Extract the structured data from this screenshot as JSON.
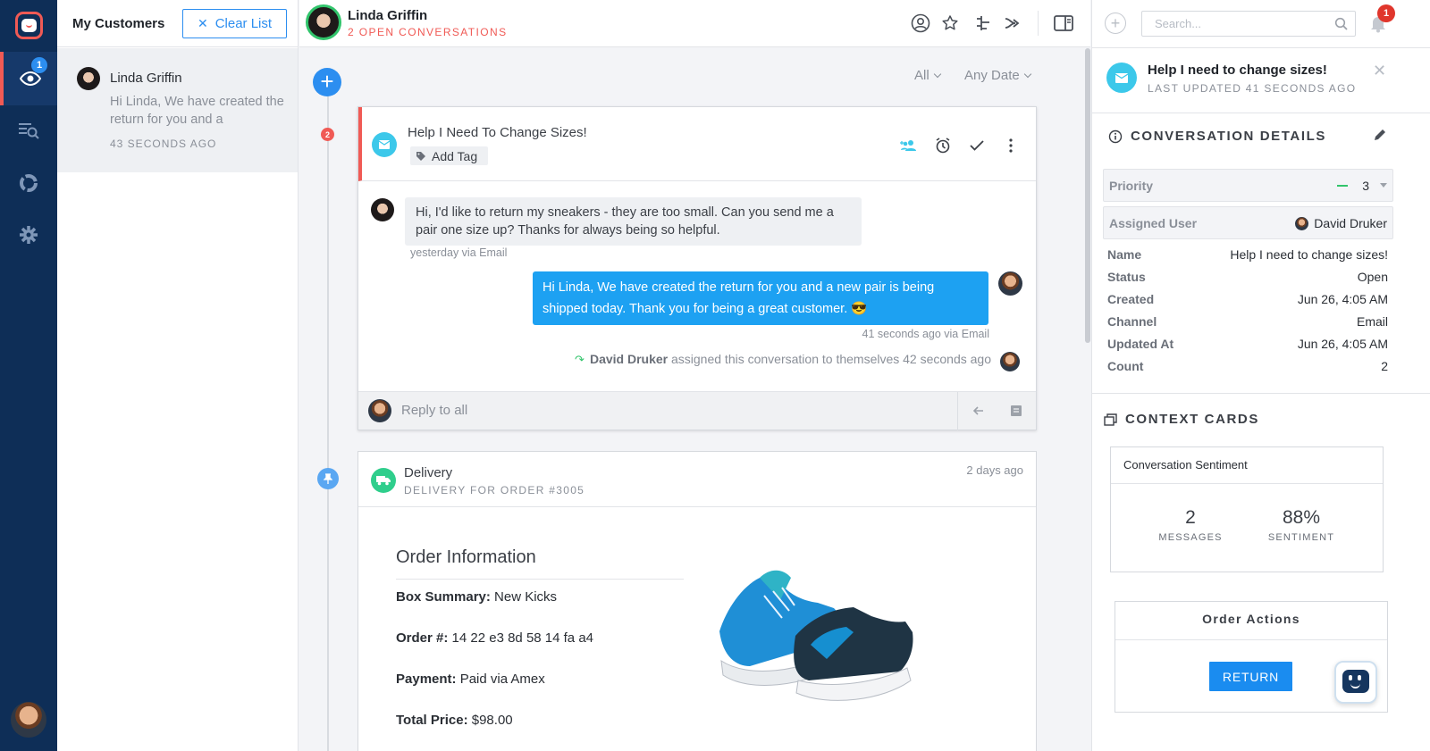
{
  "nav": {
    "items": [
      {
        "name": "eye-icon",
        "badge": "1",
        "active": true
      },
      {
        "name": "search-list-icon"
      },
      {
        "name": "reports-icon"
      },
      {
        "name": "gear-icon"
      }
    ]
  },
  "customers": {
    "title": "My Customers",
    "clear_label": "Clear List",
    "items": [
      {
        "name": "Linda Griffin",
        "preview": "Hi Linda, We have created the return for you and a",
        "time": "43 SECONDS AGO"
      }
    ]
  },
  "header": {
    "customer_name": "Linda Griffin",
    "open_conversations": "2 OPEN CONVERSATIONS",
    "icons": [
      "profile-icon",
      "star-icon",
      "tree-icon",
      "merge-icon",
      "sidebar-toggle-icon"
    ]
  },
  "conversation": {
    "filters": {
      "type": "All",
      "date": "Any Date"
    },
    "count_badge": "2",
    "title": "Help I Need To Change Sizes!",
    "tag_label": "Add Tag",
    "messages": [
      {
        "text": "Hi, I'd like to return my sneakers - they are too small. Can you send me a pair one size up? Thanks for always being so helpful.",
        "meta": "yesterday via Email"
      },
      {
        "text": "Hi Linda, We have created the return for you and a new pair is being shipped today. Thank you for being a great customer. 😎",
        "meta": "41 seconds ago via Email"
      }
    ],
    "assignment": {
      "agent": "David Druker",
      "text": "assigned this conversation to themselves 42 seconds ago"
    },
    "reply_placeholder": "Reply to all"
  },
  "delivery": {
    "title": "Delivery",
    "subtitle": "DELIVERY FOR ORDER #3005",
    "time": "2 days ago",
    "order_title": "Order Information",
    "lines": [
      {
        "label": "Box Summary:",
        "value": "New Kicks"
      },
      {
        "label": "Order #:",
        "value": "14 22 e3 8d 58 14 fa a4"
      },
      {
        "label": "Payment:",
        "value": "Paid via Amex"
      },
      {
        "label": "Total Price:",
        "value": "$98.00"
      }
    ]
  },
  "right_panel": {
    "search_placeholder": "Search...",
    "notification_count": "1",
    "convo_title": "Help I need to change sizes!",
    "convo_updated": "LAST UPDATED 41 SECONDS AGO",
    "details_title": "CONVERSATION DETAILS",
    "priority_label": "Priority",
    "priority_value": "3",
    "assigned_label": "Assigned User",
    "assigned_value": "David Druker",
    "details": [
      {
        "k": "Name",
        "v": "Help I need to change sizes!"
      },
      {
        "k": "Status",
        "v": "Open"
      },
      {
        "k": "Created",
        "v": "Jun 26, 4:05 AM"
      },
      {
        "k": "Channel",
        "v": "Email"
      },
      {
        "k": "Updated At",
        "v": "Jun 26, 4:05 AM"
      },
      {
        "k": "Count",
        "v": "2"
      }
    ],
    "context_title": "CONTEXT CARDS",
    "sentiment": {
      "title": "Conversation Sentiment",
      "messages_value": "2",
      "messages_label": "MESSAGES",
      "sentiment_value": "88%",
      "sentiment_label": "SENTIMENT"
    },
    "order_actions": {
      "title": "Order Actions",
      "button": "RETURN"
    }
  },
  "colors": {
    "accent": "#2c8ef0",
    "nav_bg": "#0e2e57",
    "alert": "#f05a55",
    "outgoing": "#1da1f2",
    "success": "#31c46b"
  }
}
